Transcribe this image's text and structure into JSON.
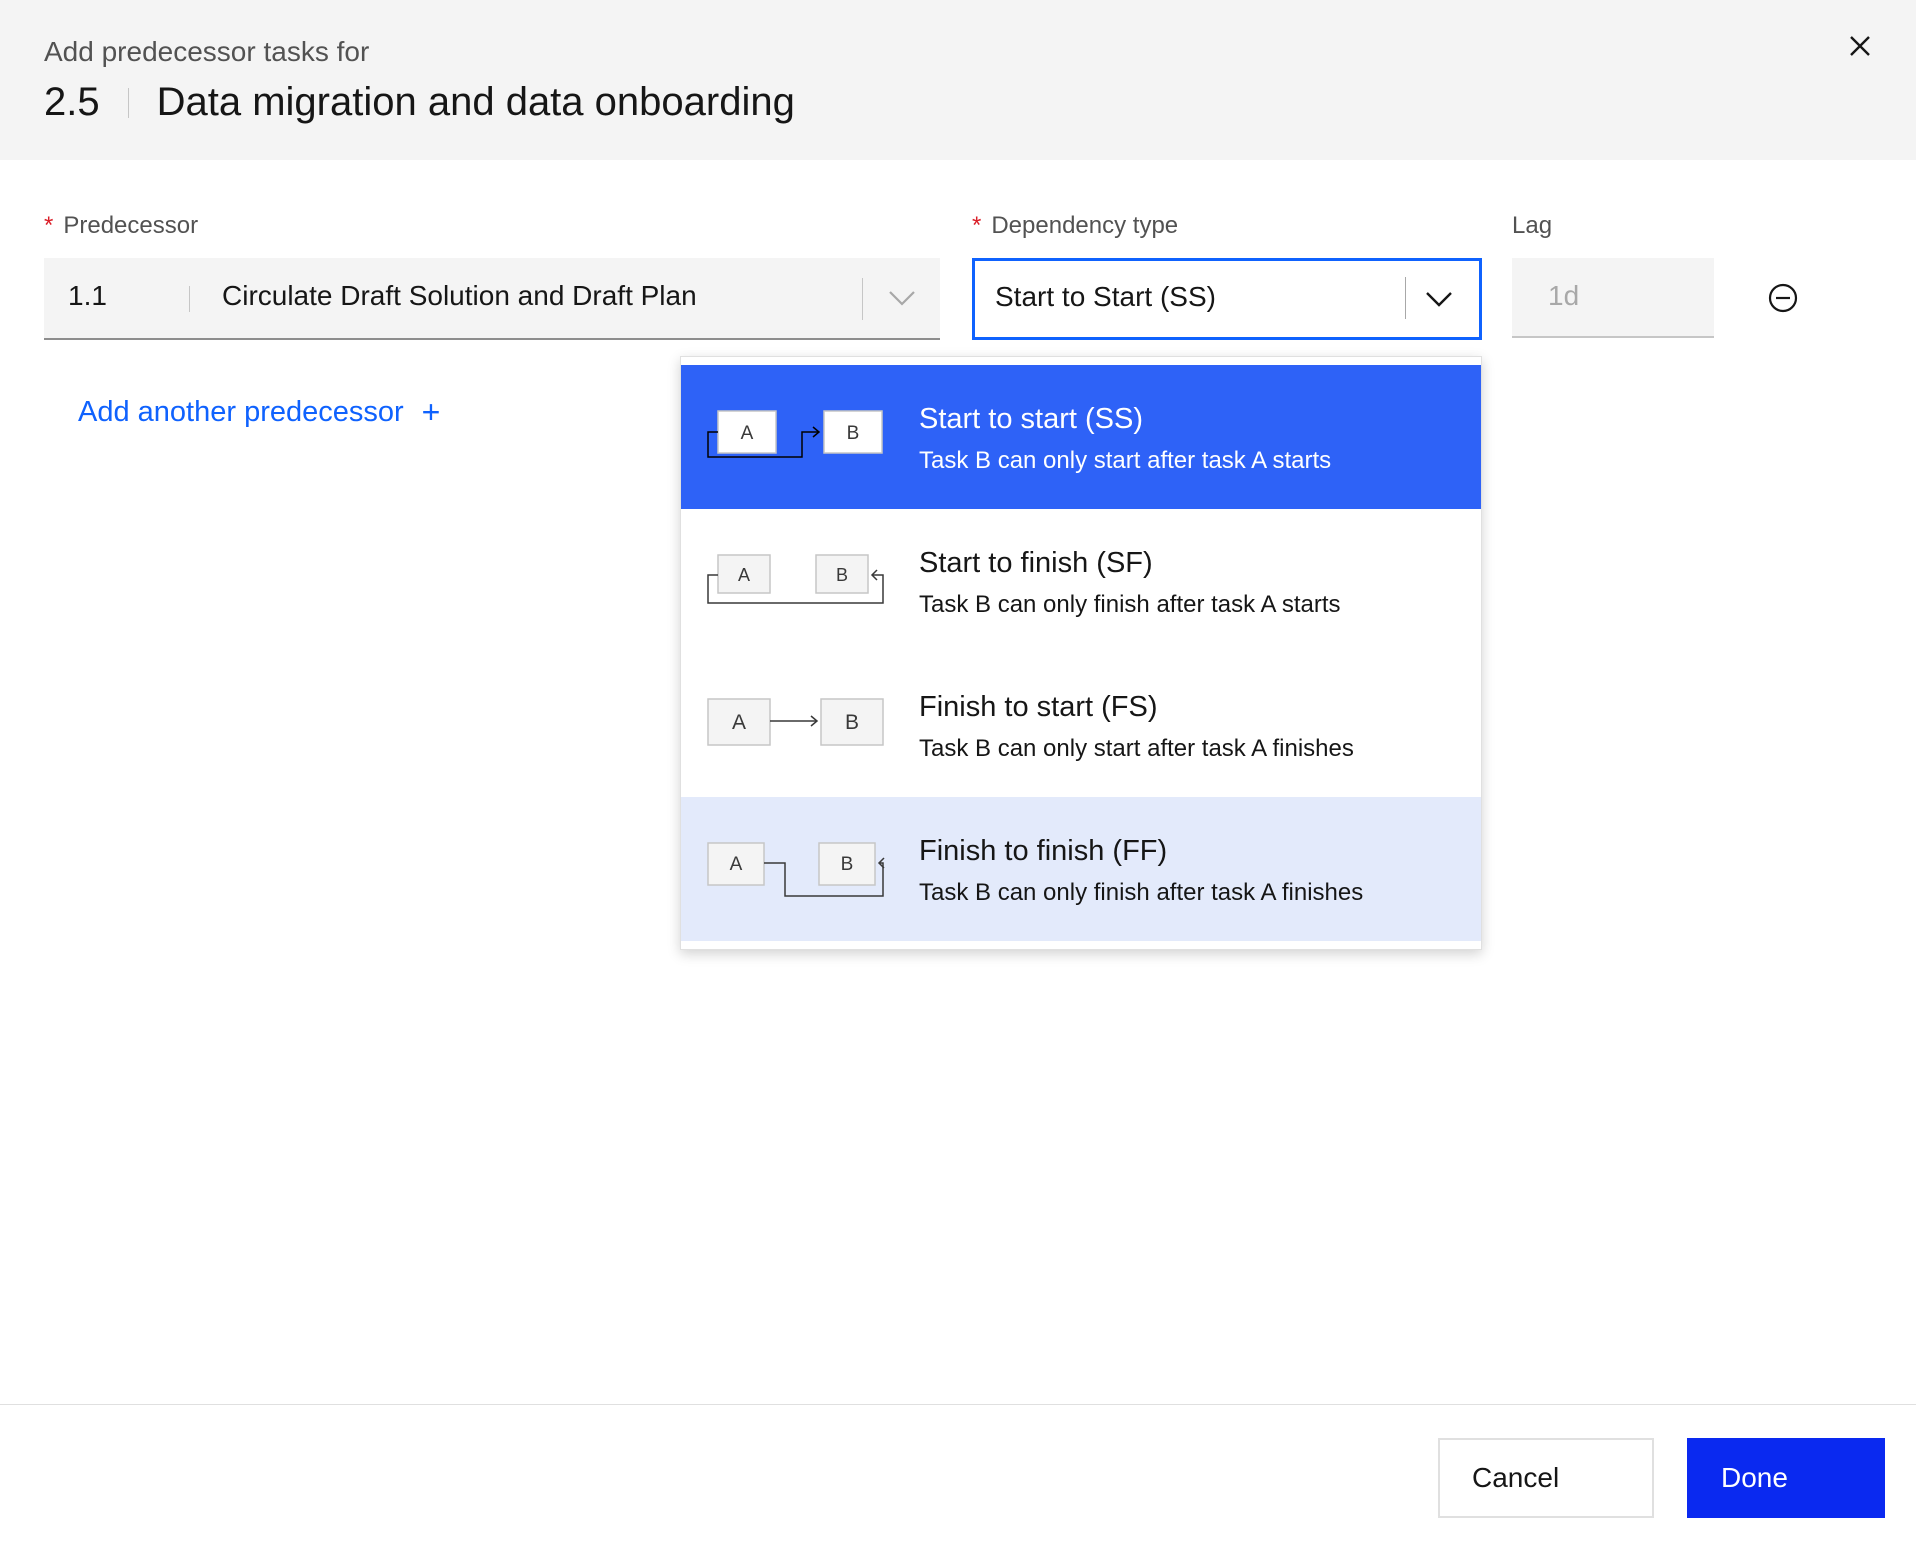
{
  "header": {
    "subtitle": "Add predecessor tasks for",
    "task_id": "2.5",
    "task_name": "Data migration and data onboarding"
  },
  "form": {
    "predecessor_label": "Predecessor",
    "dependency_label": "Dependency type",
    "lag_label": "Lag",
    "required_marker": "*",
    "predecessor_id": "1.1",
    "predecessor_name": "Circulate Draft Solution and Draft Plan",
    "dependency_value": "Start to Start (SS)",
    "lag_placeholder": "1d",
    "add_link": "Add another predecessor",
    "add_icon": "+"
  },
  "dropdown": {
    "options": [
      {
        "title": "Start to start (SS)",
        "desc": "Task B can only start after task A starts",
        "state": "selected"
      },
      {
        "title": "Start to finish (SF)",
        "desc": "Task B can only finish after task A starts",
        "state": "default"
      },
      {
        "title": "Finish to start (FS)",
        "desc": "Task B can only start after task A finishes",
        "state": "default"
      },
      {
        "title": "Finish to finish (FF)",
        "desc": "Task B can only finish after task A finishes",
        "state": "hovered"
      }
    ],
    "box_a": "A",
    "box_b": "B"
  },
  "footer": {
    "cancel": "Cancel",
    "done": "Done"
  },
  "icons": {
    "close": "close-icon",
    "chevron": "chevron-down-icon",
    "remove": "subtract-circle-icon",
    "add": "add-icon"
  },
  "colors": {
    "accent": "#0f62fe",
    "selected_option": "#2e62f7",
    "hovered_option": "#e3eafb",
    "primary_button": "#0a29f0",
    "required": "#da1e28"
  }
}
